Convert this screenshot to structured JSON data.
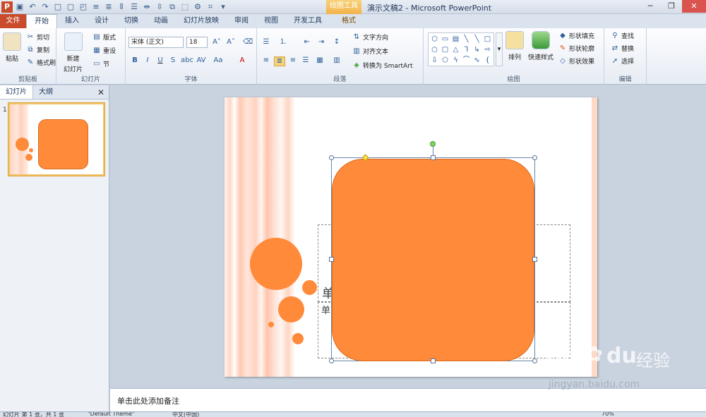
{
  "titlebar": {
    "context_tool": "绘图工具",
    "title": "演示文稿2 - Microsoft PowerPoint",
    "qat_icons": [
      "save-icon",
      "undo-icon",
      "redo-icon",
      "customize-icon"
    ]
  },
  "tabs": {
    "file": "文件",
    "items": [
      "开始",
      "插入",
      "设计",
      "切换",
      "动画",
      "幻灯片放映",
      "审阅",
      "视图",
      "开发工具"
    ],
    "context": "格式",
    "active": "开始"
  },
  "ribbon": {
    "clipboard": {
      "label": "剪贴板",
      "paste": "粘贴",
      "cut": "剪切",
      "copy": "复制",
      "format_painter": "格式刷"
    },
    "slides": {
      "label": "幻灯片",
      "new_slide": "新建",
      "new_slide_2": "幻灯片",
      "layout": "版式",
      "reset": "重设",
      "section": "节"
    },
    "font": {
      "label": "字体",
      "font_name": "宋体 (正文)",
      "font_size": "18"
    },
    "paragraph": {
      "label": "段落",
      "text_direction": "文字方向",
      "align_text": "对齐文本",
      "smartart": "转换为 SmartArt"
    },
    "drawing": {
      "label": "绘图",
      "arrange": "排列",
      "quick_styles": "快速样式",
      "shape_fill": "形状填充",
      "shape_outline": "形状轮廓",
      "shape_effects": "形状效果"
    },
    "editing": {
      "label": "编辑",
      "find": "查找",
      "replace": "替换",
      "select": "选择"
    }
  },
  "left_panel": {
    "tab_slides": "幻灯片",
    "tab_outline": "大纲",
    "slide_number": "1"
  },
  "slide": {
    "title_fragment": "单",
    "body_fragment": "单"
  },
  "notes": {
    "placeholder": "单击此处添加备注"
  },
  "status": {
    "slide_info": "幻灯片 第 1 张，共 1 张",
    "theme": "\"Default Theme\"",
    "language": "中文(中国)",
    "zoom": "70%"
  },
  "watermark": {
    "brand": "Bai",
    "brand2": "du",
    "brand_cn": "经验",
    "url": "jingyan.baidu.com"
  },
  "colors": {
    "accent_orange": "#ff8a3a",
    "file_tab": "#c94b2b",
    "selection_frame": "#6a86aa"
  }
}
